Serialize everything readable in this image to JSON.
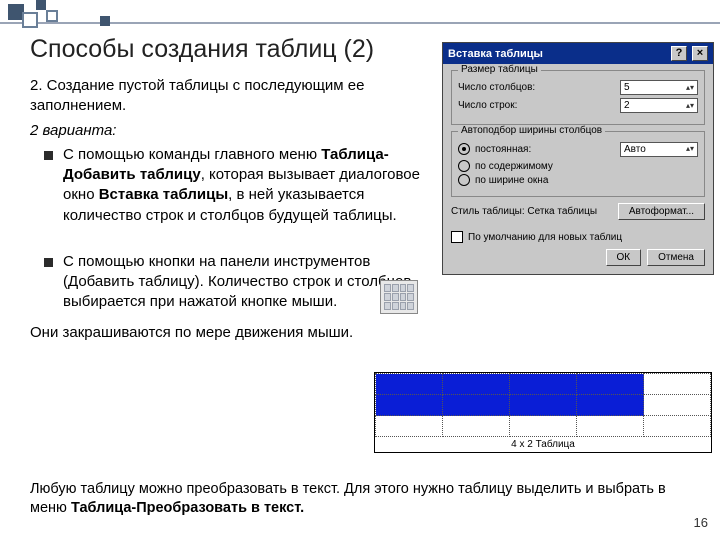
{
  "title": "Способы создания таблиц (2)",
  "intro": "2. Создание пустой таблицы с последующим ее заполнением.",
  "variants_label": "2 варианта:",
  "bullet1_pre": "С помощью команды главного меню ",
  "bullet1_bold1": "Таблица-Добавить таблицу",
  "bullet1_mid": ", которая вызывает диалоговое окно ",
  "bullet1_bold2": "Вставка таблицы",
  "bullet1_post": ", в ней указывается количество строк и столбцов будущей таблицы.",
  "bullet2": "С помощью кнопки на панели инструментов (Добавить таблицу). Количество строк и столбцов выбирается при нажатой кнопке мыши.",
  "bullet2_tail": "Они закрашиваются по мере движения мыши.",
  "footer_pre": "Любую таблицу можно преобразовать в текст. Для этого нужно таблицу выделить и выбрать в меню ",
  "footer_bold": "Таблица-Преобразовать в текст.",
  "page_number": "16",
  "dialog": {
    "title": "Вставка таблицы",
    "grp_size": "Размер таблицы",
    "cols_label": "Число столбцов:",
    "cols_value": "5",
    "rows_label": "Число строк:",
    "rows_value": "2",
    "grp_auto": "Автоподбор ширины столбцов",
    "r_fixed": "постоянная:",
    "r_fixed_value": "Авто",
    "r_content": "по содержимому",
    "r_window": "по ширине окна",
    "grp_style": "Стиль таблицы: Сетка таблицы",
    "autoformat": "Автоформат...",
    "default_check": "По умолчанию для новых таблиц",
    "ok": "ОК",
    "cancel": "Отмена"
  },
  "selgrid_caption": "4 x 2 Таблица"
}
